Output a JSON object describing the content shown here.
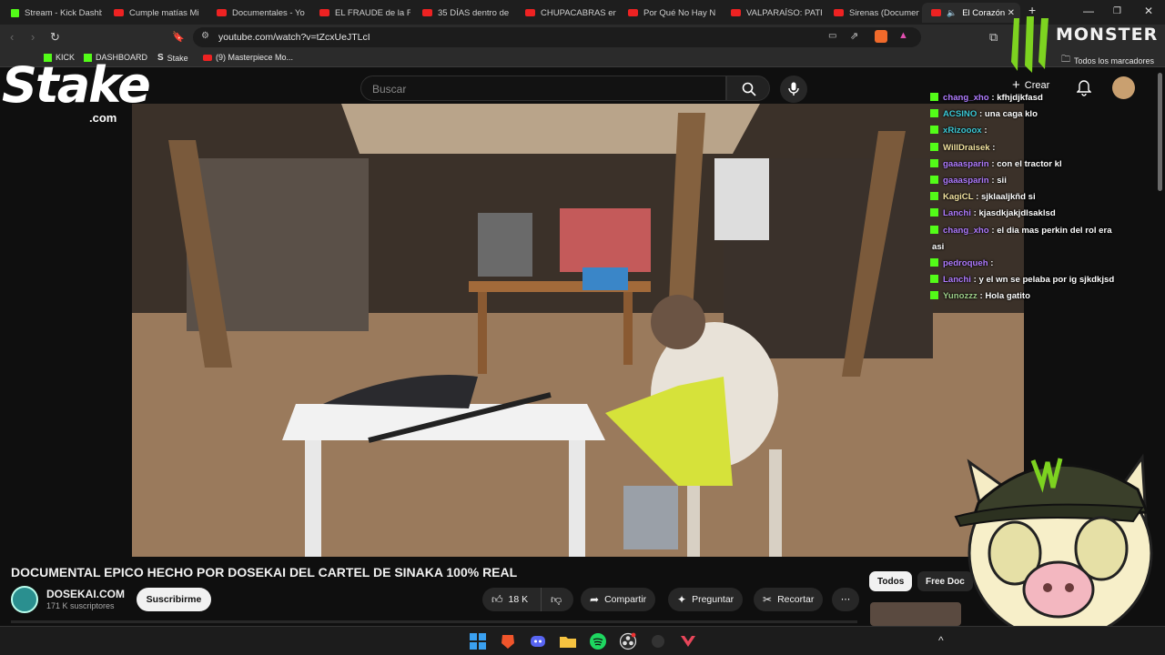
{
  "browser": {
    "tabs": [
      {
        "label": "Stream - Kick Dashb",
        "favicon": "kick-icon"
      },
      {
        "label": "Cumple matías Mi",
        "favicon": "youtube-icon"
      },
      {
        "label": "Documentales - Yo",
        "favicon": "youtube-icon"
      },
      {
        "label": "EL FRAUDE de la FI",
        "favicon": "youtube-icon"
      },
      {
        "label": "35 DÍAS dentro de",
        "favicon": "youtube-icon"
      },
      {
        "label": "CHUPACABRAS en",
        "favicon": "youtube-icon"
      },
      {
        "label": "Por Qué No Hay N",
        "favicon": "youtube-icon"
      },
      {
        "label": "VALPARAÍSO: PATR",
        "favicon": "youtube-icon"
      },
      {
        "label": "Sirenas (Documen",
        "favicon": "youtube-icon"
      },
      {
        "label": "El Corazón",
        "favicon": "youtube-icon"
      }
    ],
    "new_tab": "+",
    "url": "youtube.com/watch?v=tZcxUeJTLcI",
    "bookmarks": [
      {
        "label": "KICK",
        "icon": "kick-icon"
      },
      {
        "label": "DASHBOARD",
        "icon": "kick-icon"
      },
      {
        "label": "Stake",
        "icon": "stake-icon"
      },
      {
        "label": "(9) Masterpiece Mo...",
        "icon": "youtube-icon"
      }
    ],
    "all_bookmarks": "Todos los marcadores"
  },
  "overlay": {
    "stake_logo": "Stake",
    "stake_sub": ".com",
    "monster_logo": "MONSTER"
  },
  "youtube": {
    "search_placeholder": "Buscar",
    "create_label": "Crear",
    "video_title": "DOCUMENTAL EPICO HECHO POR DOSEKAI DEL CARTEL DE SINAKA 100% REAL",
    "channel_name": "DOSEKAI.COM",
    "subscribers": "171 K suscriptores",
    "subscribe_label": "Suscribirme",
    "likes": "18 K",
    "share_label": "Compartir",
    "ask_label": "Preguntar",
    "clip_label": "Recortar",
    "more_label": "⋯",
    "chips": [
      "Todos",
      "Free Doc"
    ]
  },
  "chat": [
    {
      "user": "chang_xho",
      "text": "kfhjdjkfasd",
      "color": "#b07cff"
    },
    {
      "user": "ACSINO",
      "text": "una caga klo",
      "color": "#3cc9d6"
    },
    {
      "user": "xRizooox",
      "text": "",
      "color": "#3cc9d6"
    },
    {
      "user": "WillDraisek",
      "text": "",
      "color": "#f3e3a0"
    },
    {
      "user": "gaaasparin",
      "text": "con el tractor kl",
      "color": "#b07cff"
    },
    {
      "user": "gaaasparin",
      "text": "sii",
      "color": "#b07cff"
    },
    {
      "user": "KagiCL",
      "text": "sjklaaljkñd si",
      "color": "#f3e3a0"
    },
    {
      "user": "Lanchi",
      "text": "kjasdkjakjdlsaklsd",
      "color": "#b07cff"
    },
    {
      "user": "chang_xho",
      "text": "el dia mas perkin del rol era",
      "color": "#b07cff"
    },
    {
      "user": "",
      "text": "asi",
      "color": "#fff"
    },
    {
      "user": "pedroqueh",
      "text": "",
      "color": "#b07cff"
    },
    {
      "user": "Lanchi",
      "text": "y el wn se pelaba por ig sjkdkjsd",
      "color": "#b07cff"
    },
    {
      "user": "Yunozzz",
      "text": "Hola gatito",
      "color": "#9fd08a"
    }
  ],
  "colors": {
    "kick_green": "#53fc18",
    "youtube_red": "#ff0000",
    "monster_green": "#7dd320"
  }
}
